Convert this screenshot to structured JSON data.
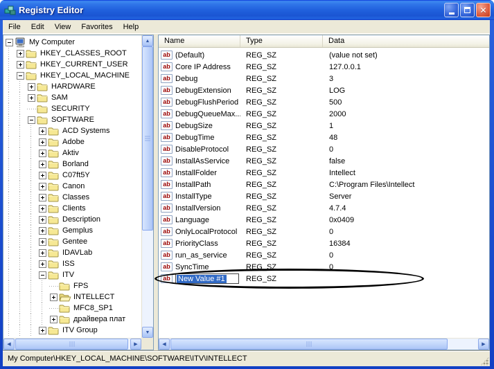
{
  "window": {
    "title": "Registry Editor"
  },
  "titlebar": {
    "buttons": {
      "minimize": "minimize",
      "maximize": "maximize",
      "close": "close"
    }
  },
  "menu": {
    "items": [
      "File",
      "Edit",
      "View",
      "Favorites",
      "Help"
    ]
  },
  "tree": {
    "items": [
      {
        "label": "My Computer",
        "level": 0,
        "expander": "minus",
        "icon": "computer"
      },
      {
        "label": "HKEY_CLASSES_ROOT",
        "level": 1,
        "expander": "plus",
        "icon": "folder"
      },
      {
        "label": "HKEY_CURRENT_USER",
        "level": 1,
        "expander": "plus",
        "icon": "folder"
      },
      {
        "label": "HKEY_LOCAL_MACHINE",
        "level": 1,
        "expander": "minus",
        "icon": "folder"
      },
      {
        "label": "HARDWARE",
        "level": 2,
        "expander": "plus",
        "icon": "folder"
      },
      {
        "label": "SAM",
        "level": 2,
        "expander": "plus",
        "icon": "folder"
      },
      {
        "label": "SECURITY",
        "level": 2,
        "expander": "none",
        "icon": "folder"
      },
      {
        "label": "SOFTWARE",
        "level": 2,
        "expander": "minus",
        "icon": "folder"
      },
      {
        "label": "ACD Systems",
        "level": 3,
        "expander": "plus",
        "icon": "folder"
      },
      {
        "label": "Adobe",
        "level": 3,
        "expander": "plus",
        "icon": "folder"
      },
      {
        "label": "Aktiv",
        "level": 3,
        "expander": "plus",
        "icon": "folder"
      },
      {
        "label": "Borland",
        "level": 3,
        "expander": "plus",
        "icon": "folder"
      },
      {
        "label": "C07ft5Y",
        "level": 3,
        "expander": "plus",
        "icon": "folder"
      },
      {
        "label": "Canon",
        "level": 3,
        "expander": "plus",
        "icon": "folder"
      },
      {
        "label": "Classes",
        "level": 3,
        "expander": "plus",
        "icon": "folder"
      },
      {
        "label": "Clients",
        "level": 3,
        "expander": "plus",
        "icon": "folder"
      },
      {
        "label": "Description",
        "level": 3,
        "expander": "plus",
        "icon": "folder"
      },
      {
        "label": "Gemplus",
        "level": 3,
        "expander": "plus",
        "icon": "folder"
      },
      {
        "label": "Gentee",
        "level": 3,
        "expander": "plus",
        "icon": "folder"
      },
      {
        "label": "IDAVLab",
        "level": 3,
        "expander": "plus",
        "icon": "folder"
      },
      {
        "label": "ISS",
        "level": 3,
        "expander": "plus",
        "icon": "folder"
      },
      {
        "label": "ITV",
        "level": 3,
        "expander": "minus",
        "icon": "folder"
      },
      {
        "label": "FPS",
        "level": 4,
        "expander": "none",
        "icon": "folder"
      },
      {
        "label": "INTELLECT",
        "level": 4,
        "expander": "plus",
        "icon": "folder-open"
      },
      {
        "label": "MFC8_SP1",
        "level": 4,
        "expander": "none",
        "icon": "folder"
      },
      {
        "label": "драйвера плат",
        "level": 4,
        "expander": "plus",
        "icon": "folder"
      },
      {
        "label": "ITV Group",
        "level": 3,
        "expander": "plus",
        "icon": "folder"
      }
    ]
  },
  "list": {
    "columns": [
      "Name",
      "Type",
      "Data"
    ],
    "rows": [
      {
        "name": "(Default)",
        "type": "REG_SZ",
        "data": "(value not set)",
        "icon": "string-value",
        "selected": false
      },
      {
        "name": "Core IP Address",
        "type": "REG_SZ",
        "data": "127.0.0.1",
        "icon": "string-value",
        "selected": false
      },
      {
        "name": "Debug",
        "type": "REG_SZ",
        "data": "3",
        "icon": "string-value",
        "selected": false
      },
      {
        "name": "DebugExtension",
        "type": "REG_SZ",
        "data": "LOG",
        "icon": "string-value",
        "selected": false
      },
      {
        "name": "DebugFlushPeriod",
        "type": "REG_SZ",
        "data": "500",
        "icon": "string-value",
        "selected": false
      },
      {
        "name": "DebugQueueMax...",
        "type": "REG_SZ",
        "data": "2000",
        "icon": "string-value",
        "selected": false
      },
      {
        "name": "DebugSize",
        "type": "REG_SZ",
        "data": "1",
        "icon": "string-value",
        "selected": false
      },
      {
        "name": "DebugTime",
        "type": "REG_SZ",
        "data": "48",
        "icon": "string-value",
        "selected": false
      },
      {
        "name": "DisableProtocol",
        "type": "REG_SZ",
        "data": "0",
        "icon": "string-value",
        "selected": false
      },
      {
        "name": "InstallAsService",
        "type": "REG_SZ",
        "data": "false",
        "icon": "string-value",
        "selected": false
      },
      {
        "name": "InstallFolder",
        "type": "REG_SZ",
        "data": "Intellect",
        "icon": "string-value",
        "selected": false
      },
      {
        "name": "InstallPath",
        "type": "REG_SZ",
        "data": "C:\\Program Files\\Intellect",
        "icon": "string-value",
        "selected": false
      },
      {
        "name": "InstallType",
        "type": "REG_SZ",
        "data": "Server",
        "icon": "string-value",
        "selected": false
      },
      {
        "name": "InstallVersion",
        "type": "REG_SZ",
        "data": "4.7.4",
        "icon": "string-value",
        "selected": false
      },
      {
        "name": "Language",
        "type": "REG_SZ",
        "data": "0x0409",
        "icon": "string-value",
        "selected": false
      },
      {
        "name": "OnlyLocalProtocol",
        "type": "REG_SZ",
        "data": "0",
        "icon": "string-value",
        "selected": false
      },
      {
        "name": "PriorityClass",
        "type": "REG_SZ",
        "data": "16384",
        "icon": "string-value",
        "selected": false
      },
      {
        "name": "run_as_service",
        "type": "REG_SZ",
        "data": "0",
        "icon": "string-value",
        "selected": false
      },
      {
        "name": "SyncTime",
        "type": "REG_SZ",
        "data": "0",
        "icon": "string-value",
        "selected": false
      },
      {
        "name": "New Value #1",
        "type": "REG_SZ",
        "data": "",
        "icon": "string-value",
        "selected": true
      }
    ]
  },
  "annotation": {
    "shape": "ellipse",
    "target": "New Value #1 row"
  },
  "statusbar": {
    "path": "My Computer\\HKEY_LOCAL_MACHINE\\SOFTWARE\\ITV\\INTELLECT"
  },
  "colors": {
    "selection_blue": "#316AC5",
    "titlebar_blue": "#2162DE",
    "frame_blue": "#1240C4",
    "chrome_face": "#ECE9D8",
    "close_button_red": "#D8502F",
    "value_icon_red": "#990000"
  }
}
